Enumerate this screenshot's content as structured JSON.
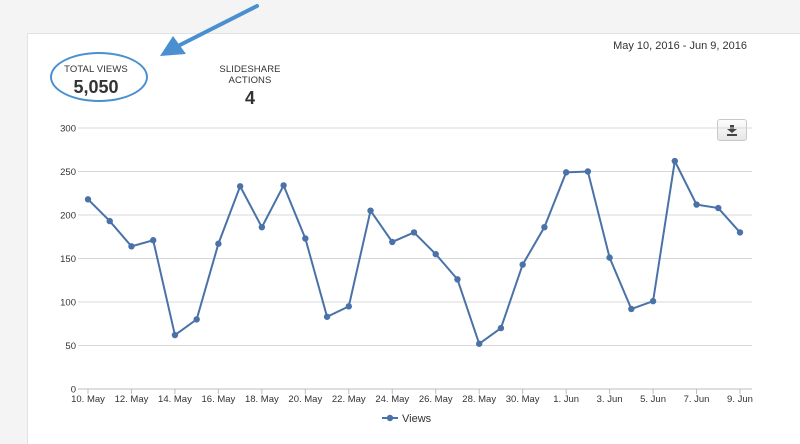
{
  "header": {
    "date_range": "May 10, 2016 - Jun 9, 2016"
  },
  "stats": {
    "total_views_label": "TOTAL VIEWS",
    "total_views_value": "5,050",
    "actions_label": "SLIDESHARE ACTIONS",
    "actions_value": "4"
  },
  "icons": {
    "download": "download-icon",
    "annotation": "arrow-icon"
  },
  "colors": {
    "line": "#4a72a8",
    "annotation": "#4a90d0",
    "grid": "#d8d8d8"
  },
  "chart_data": {
    "type": "line",
    "ylim": [
      0,
      300
    ],
    "yticks": [
      0,
      50,
      100,
      150,
      200,
      250,
      300
    ],
    "xtick_labels": [
      "10. May",
      "12. May",
      "14. May",
      "16. May",
      "18. May",
      "20. May",
      "22. May",
      "24. May",
      "26. May",
      "28. May",
      "30. May",
      "1. Jun",
      "3. Jun",
      "5. Jun",
      "7. Jun",
      "9. Jun"
    ],
    "legend": "bottom-center",
    "series": [
      {
        "name": "Views",
        "values": [
          218,
          193,
          164,
          171,
          62,
          80,
          167,
          233,
          186,
          234,
          173,
          83,
          95,
          205,
          169,
          180,
          155,
          126,
          52,
          70,
          143,
          186,
          249,
          250,
          151,
          92,
          101,
          262,
          212,
          208,
          180
        ]
      }
    ]
  }
}
